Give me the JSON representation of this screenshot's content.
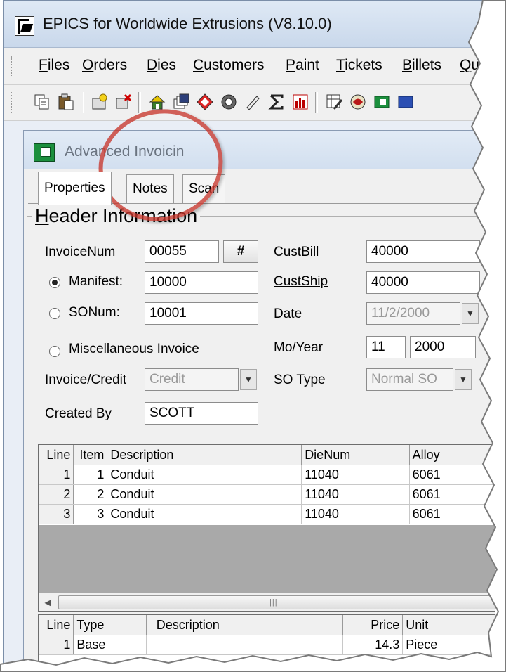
{
  "window": {
    "title": "EPICS for Worldwide Extrusions (V8.10.0)"
  },
  "menu": [
    "Files",
    "Orders",
    "Dies",
    "Customers",
    "Paint",
    "Tickets",
    "Billets",
    "Quo"
  ],
  "toolbar": {
    "icons": [
      "copy-icon",
      "paste-icon",
      "new-order-icon",
      "delete-order-icon",
      "house-icon",
      "documents-icon",
      "diamond-icon",
      "circle-icon",
      "pen-icon",
      "sum-icon",
      "chart-icon",
      "edit-grid-icon",
      "globe-icon",
      "window-icon"
    ]
  },
  "child_window": {
    "title": "Advanced Invoicin"
  },
  "tabs": [
    "Properties",
    "Notes",
    "Scan"
  ],
  "header": {
    "group_label": "Header Information",
    "invoice_num_label": "InvoiceNum",
    "invoice_num_value": "00055",
    "hash_button": "#",
    "manifest_label": "Manifest:",
    "manifest_value": "10000",
    "sonum_label": "SONum:",
    "sonum_value": "10001",
    "misc_invoice_label": "Miscellaneous Invoice",
    "invoice_credit_label": "Invoice/Credit",
    "invoice_credit_value": "Credit",
    "created_by_label": "Created By",
    "created_by_value": "SCOTT",
    "custbill_label": "CustBill",
    "custbill_value": "40000",
    "custship_label": "CustShip",
    "custship_value": "40000",
    "date_label": "Date",
    "date_value": "11/2/2000",
    "moyear_label": "Mo/Year",
    "month_value": "11",
    "year_value": "2000",
    "so_type_label": "SO Type",
    "so_type_value": "Normal SO",
    "edge_labels": [
      "C",
      "B",
      "C",
      "C",
      "St"
    ]
  },
  "lines_grid": {
    "columns": [
      "Line",
      "Item",
      "Description",
      "DieNum",
      "Alloy"
    ],
    "rows": [
      {
        "line": "1",
        "item": "1",
        "description": "Conduit",
        "dienum": "11040",
        "alloy": "6061"
      },
      {
        "line": "2",
        "item": "2",
        "description": "Conduit",
        "dienum": "11040",
        "alloy": "6061"
      },
      {
        "line": "3",
        "item": "3",
        "description": "Conduit",
        "dienum": "11040",
        "alloy": "6061"
      }
    ]
  },
  "charges_grid": {
    "columns": [
      "Line",
      "Type",
      "Description",
      "Price",
      "Unit"
    ],
    "rows": [
      {
        "line": "1",
        "type": "Base",
        "description": "",
        "price": "14.3",
        "unit": "Piece"
      }
    ]
  },
  "colors": {
    "annotation": "#c8372d",
    "title_gradient_top": "#dfe9f5"
  }
}
